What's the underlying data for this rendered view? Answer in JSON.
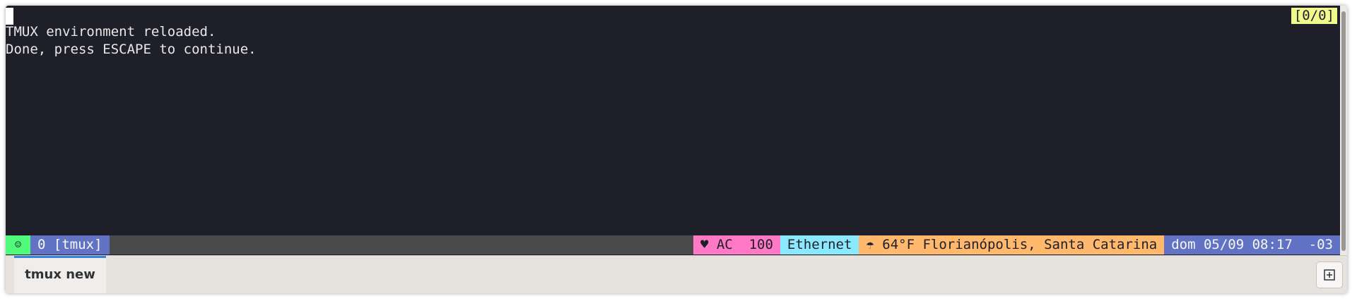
{
  "terminal": {
    "lines": [
      "TMUX environment reloaded.",
      "Done, press ESCAPE to continue."
    ],
    "pane_indicator": "[0/0]"
  },
  "statusbar": {
    "session_icon": "☺",
    "window": "0 [tmux]",
    "power": "♥ AC  100",
    "network": "Ethernet",
    "weather": "☂ 64°F Florianópolis, Santa Catarina",
    "datetime": "dom 05/09 08:17  -03"
  },
  "tabs": [
    {
      "label": "tmux new",
      "active": true
    }
  ],
  "icons": {
    "new_tab": "add-tab-icon"
  },
  "colors": {
    "terminal_bg": "#1e1f29",
    "accent_green": "#50fa7b",
    "accent_purple": "#6272c4",
    "accent_pink": "#ff79c6",
    "accent_cyan": "#8be9fd",
    "accent_orange": "#ffb86c",
    "accent_yellow": "#f1fa8c",
    "tab_indicator": "#3584e4"
  }
}
